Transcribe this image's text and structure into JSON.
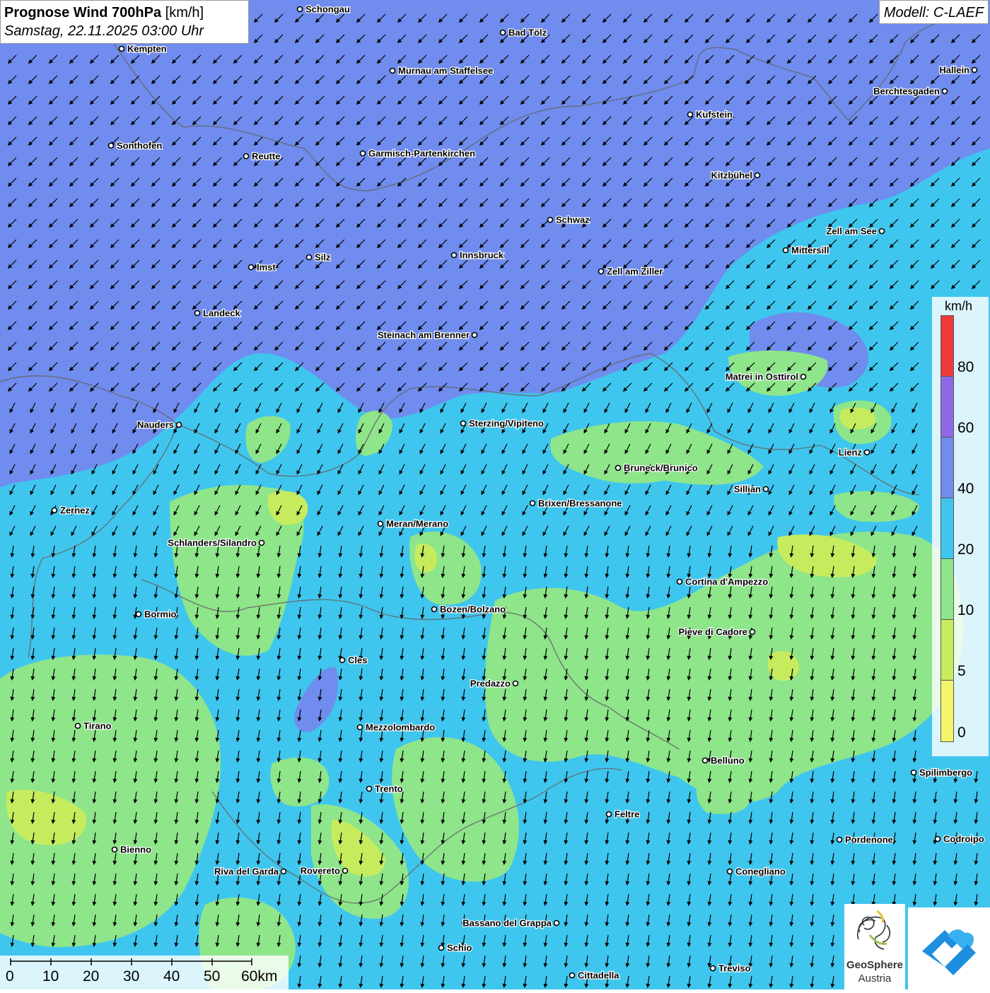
{
  "header": {
    "title": "Prognose Wind 700hPa",
    "unit": "[km/h]",
    "datetime": "Samstag, 22.11.2025 03:00 Uhr",
    "model": "Modell: C-LAEF"
  },
  "legend": {
    "unit": "km/h",
    "ticks": [
      "80",
      "60",
      "40",
      "20",
      "10",
      "5",
      "0"
    ],
    "classes": [
      {
        "from": 0,
        "to": 5,
        "color": "#f4f56a"
      },
      {
        "from": 5,
        "to": 10,
        "color": "#c6ec5e"
      },
      {
        "from": 10,
        "to": 20,
        "color": "#8ee58a"
      },
      {
        "from": 20,
        "to": 40,
        "color": "#3fc6ee"
      },
      {
        "from": 40,
        "to": 60,
        "color": "#6f8cee"
      },
      {
        "from": 60,
        "to": 80,
        "color": "#8f68e6"
      },
      {
        "from": 80,
        "to": 100,
        "color": "#ef3a3a"
      }
    ]
  },
  "scale_bar": {
    "labels": [
      "0",
      "10",
      "20",
      "30",
      "40",
      "50",
      "60km"
    ]
  },
  "wind": {
    "direction": "north-east, arrows pointing south-west in the north and south in the south"
  },
  "cities": [
    {
      "name": "Schongau"
    },
    {
      "name": "Bad Tölz"
    },
    {
      "name": "Kempten"
    },
    {
      "name": "Murnau am Staffelsee"
    },
    {
      "name": "Hallein"
    },
    {
      "name": "Berchtesgaden"
    },
    {
      "name": "Kufstein"
    },
    {
      "name": "Sonthofen"
    },
    {
      "name": "Reutte"
    },
    {
      "name": "Garmisch-Partenkirchen"
    },
    {
      "name": "Kitzbühel"
    },
    {
      "name": "Schwaz"
    },
    {
      "name": "Zell am See"
    },
    {
      "name": "Mittersill"
    },
    {
      "name": "Innsbruck"
    },
    {
      "name": "Silz"
    },
    {
      "name": "Imst"
    },
    {
      "name": "Zell am Ziller"
    },
    {
      "name": "Landeck"
    },
    {
      "name": "Steinach am Brenner"
    },
    {
      "name": "Matrei in Osttirol"
    },
    {
      "name": "Nauders"
    },
    {
      "name": "Sterzing/Vipiteno"
    },
    {
      "name": "Lienz"
    },
    {
      "name": "Bruneck/Brunico"
    },
    {
      "name": "Zernez"
    },
    {
      "name": "Sillian"
    },
    {
      "name": "Brixen/Bressanone"
    },
    {
      "name": "Meran/Merano"
    },
    {
      "name": "Schlanders/Silandro"
    },
    {
      "name": "Cortina d'Ampezzo"
    },
    {
      "name": "Bozen/Bolzano"
    },
    {
      "name": "Bormio"
    },
    {
      "name": "Pieve di Cadore"
    },
    {
      "name": "Cles"
    },
    {
      "name": "Predazzo"
    },
    {
      "name": "Tirano"
    },
    {
      "name": "Mezzolombardo"
    },
    {
      "name": "Belluno"
    },
    {
      "name": "Spilimbergo"
    },
    {
      "name": "Trento"
    },
    {
      "name": "Feltre"
    },
    {
      "name": "Pordenone"
    },
    {
      "name": "Codroipo"
    },
    {
      "name": "Bienno"
    },
    {
      "name": "Riva del Garda"
    },
    {
      "name": "Rovereto"
    },
    {
      "name": "Conegliano"
    },
    {
      "name": "Bassano del Grappa"
    },
    {
      "name": "Schio"
    },
    {
      "name": "Treviso"
    },
    {
      "name": "Cittadella"
    }
  ],
  "logos": {
    "geosphere_line1": "GeoSphere",
    "geosphere_line2": "Austria"
  }
}
